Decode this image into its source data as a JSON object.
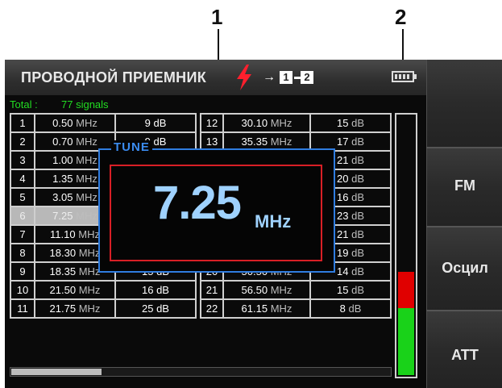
{
  "callouts": [
    "1",
    "2"
  ],
  "header": {
    "title": "ПРОВОДНОЙ ПРИЕМНИК",
    "io_arrow": "→",
    "port_1": "1",
    "port_2": "2"
  },
  "status": {
    "total_label": "Total :",
    "total_value": "77 signals"
  },
  "left_table": [
    {
      "n": "1",
      "freq": "0.50",
      "unit": "MHz",
      "level": "9 dB"
    },
    {
      "n": "2",
      "freq": "0.70",
      "unit": "MHz",
      "level": "9 dB"
    },
    {
      "n": "3",
      "freq": "1.00",
      "unit": "MHz",
      "level": ""
    },
    {
      "n": "4",
      "freq": "1.35",
      "unit": "MHz",
      "level": ""
    },
    {
      "n": "5",
      "freq": "3.05",
      "unit": "MHz",
      "level": ""
    },
    {
      "n": "6",
      "freq": "7.25",
      "unit": "MHz",
      "level": ""
    },
    {
      "n": "7",
      "freq": "11.10",
      "unit": "MHz",
      "level": ""
    },
    {
      "n": "8",
      "freq": "18.30",
      "unit": "MHz",
      "level": "10 dB"
    },
    {
      "n": "9",
      "freq": "18.35",
      "unit": "MHz",
      "level": "15 dB"
    },
    {
      "n": "10",
      "freq": "21.50",
      "unit": "MHz",
      "level": "16 dB"
    },
    {
      "n": "11",
      "freq": "21.75",
      "unit": "MHz",
      "level": "25 dB"
    }
  ],
  "right_table": [
    {
      "n": "12",
      "freq": "30.10",
      "unit": "MHz",
      "level": "15",
      "lunit": "dB"
    },
    {
      "n": "13",
      "freq": "35.35",
      "unit": "MHz",
      "level": "17",
      "lunit": "dB"
    },
    {
      "n": "14",
      "freq": "",
      "unit": "",
      "level": "21",
      "lunit": "dB"
    },
    {
      "n": "15",
      "freq": "",
      "unit": "",
      "level": "20",
      "lunit": "dB"
    },
    {
      "n": "16",
      "freq": "",
      "unit": "",
      "level": "16",
      "lunit": "dB"
    },
    {
      "n": "17",
      "freq": "",
      "unit": "",
      "level": "23",
      "lunit": "dB"
    },
    {
      "n": "18",
      "freq": "",
      "unit": "",
      "level": "21",
      "lunit": "dB"
    },
    {
      "n": "19",
      "freq": "42.35",
      "unit": "MHz",
      "level": "19",
      "lunit": "dB"
    },
    {
      "n": "20",
      "freq": "50.50",
      "unit": "MHz",
      "level": "14",
      "lunit": "dB"
    },
    {
      "n": "21",
      "freq": "56.50",
      "unit": "MHz",
      "level": "15",
      "lunit": "dB"
    },
    {
      "n": "22",
      "freq": "61.15",
      "unit": "MHz",
      "level": "8",
      "lunit": "dB"
    }
  ],
  "selected_row": 6,
  "tune": {
    "label": "TUNE",
    "value": "7.25",
    "unit": "MHz"
  },
  "meter": {
    "green_fraction": 0.26,
    "red_fraction": 0.14
  },
  "softkeys": [
    "",
    "FM",
    "Осцил",
    "ATT"
  ],
  "colors": {
    "accent_blue": "#2f7de0",
    "accent_red": "#d81f26",
    "status_green": "#22dd22",
    "bolt_red": "#ff1f2d"
  },
  "icons": [
    "lightning-icon",
    "battery-icon"
  ]
}
